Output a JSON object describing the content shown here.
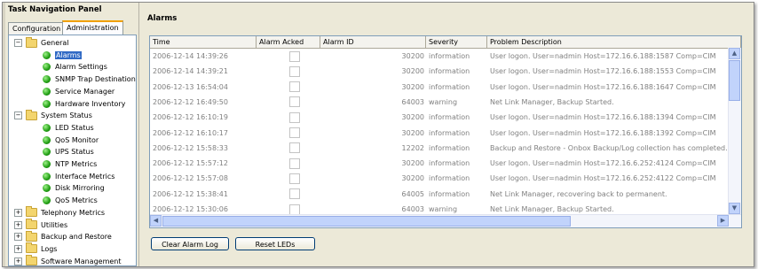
{
  "left_panel": {
    "title": "Task Navigation Panel",
    "tabs": [
      {
        "label": "Configuration"
      },
      {
        "label": "Administration"
      }
    ],
    "tree": [
      {
        "type": "folder",
        "label": "General",
        "exp": "−"
      },
      {
        "type": "leaf",
        "label": "Alarms",
        "selected": true
      },
      {
        "type": "leaf",
        "label": "Alarm Settings"
      },
      {
        "type": "leaf",
        "label": "SNMP Trap Destination"
      },
      {
        "type": "leaf",
        "label": "Service Manager"
      },
      {
        "type": "leaf",
        "label": "Hardware Inventory"
      },
      {
        "type": "folder",
        "label": "System Status",
        "exp": "−"
      },
      {
        "type": "leaf",
        "label": "LED Status"
      },
      {
        "type": "leaf",
        "label": "QoS Monitor"
      },
      {
        "type": "leaf",
        "label": "UPS Status"
      },
      {
        "type": "leaf",
        "label": "NTP Metrics"
      },
      {
        "type": "leaf",
        "label": "Interface Metrics"
      },
      {
        "type": "leaf",
        "label": "Disk Mirroring"
      },
      {
        "type": "leaf",
        "label": "QoS Metrics"
      },
      {
        "type": "folder",
        "label": "Telephony Metrics",
        "exp": "+"
      },
      {
        "type": "folder",
        "label": "Utilities",
        "exp": "+"
      },
      {
        "type": "folder",
        "label": "Backup and Restore",
        "exp": "+"
      },
      {
        "type": "folder",
        "label": "Logs",
        "exp": "+"
      },
      {
        "type": "folder",
        "label": "Software Management",
        "exp": "+"
      }
    ]
  },
  "main": {
    "title": "Alarms",
    "columns": [
      "Time",
      "Alarm Acked",
      "Alarm ID",
      "Severity",
      "Problem Description"
    ],
    "rows": [
      {
        "time": "2006-12-14 14:39:26",
        "id": "30200",
        "severity": "information",
        "desc": "User logon. User=nadmin Host=172.16.6.188:1587 Comp=CIM"
      },
      {
        "time": "2006-12-14 14:39:21",
        "id": "30200",
        "severity": "information",
        "desc": "User logon. User=nadmin Host=172.16.6.188:1553 Comp=CIM"
      },
      {
        "time": "2006-12-13 16:54:04",
        "id": "30200",
        "severity": "information",
        "desc": "User logon. User=nadmin Host=172.16.6.188:1647 Comp=CIM"
      },
      {
        "time": "2006-12-12 16:49:50",
        "id": "64003",
        "severity": "warning",
        "desc": "Net Link Manager, Backup Started."
      },
      {
        "time": "2006-12-12 16:10:19",
        "id": "30200",
        "severity": "information",
        "desc": "User logon. User=nadmin Host=172.16.6.188:1394 Comp=CIM"
      },
      {
        "time": "2006-12-12 16:10:17",
        "id": "30200",
        "severity": "information",
        "desc": "User logon. User=nadmin Host=172.16.6.188:1392 Comp=CIM"
      },
      {
        "time": "2006-12-12 15:58:33",
        "id": "12202",
        "severity": "information",
        "desc": "Backup and Restore - Onbox Backup/Log collection has completed."
      },
      {
        "time": "2006-12-12 15:57:12",
        "id": "30200",
        "severity": "information",
        "desc": "User logon. User=nadmin Host=172.16.6.252:4124 Comp=CIM"
      },
      {
        "time": "2006-12-12 15:57:08",
        "id": "30200",
        "severity": "information",
        "desc": "User logon. User=nadmin Host=172.16.6.252:4122 Comp=CIM"
      },
      {
        "time": "2006-12-12 15:38:41",
        "id": "64005",
        "severity": "information",
        "desc": "Net Link Manager, recovering back to permanent."
      },
      {
        "time": "2006-12-12 15:30:06",
        "id": "64003",
        "severity": "warning",
        "desc": "Net Link Manager, Backup Started."
      }
    ],
    "buttons": {
      "clear": "Clear Alarm Log",
      "reset": "Reset LEDs"
    }
  }
}
